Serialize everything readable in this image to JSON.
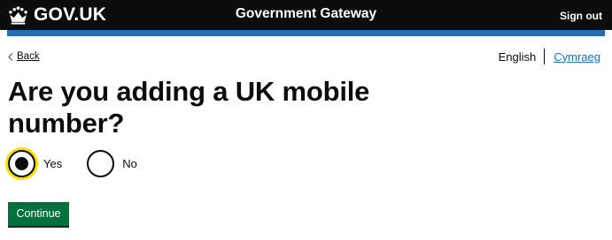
{
  "header": {
    "logo_text": "GOV.UK",
    "logo_icon": "crown-icon",
    "service_name": "Government Gateway",
    "sign_out_label": "Sign out",
    "background_color": "#0b0c0c",
    "accent_bar_color": "#1d70b8"
  },
  "nav": {
    "back_label": "Back",
    "back_icon": "chevron-left-icon"
  },
  "language": {
    "current": "English",
    "alternate": "Cymraeg",
    "link_color": "#1d70b8"
  },
  "question": {
    "title": "Are you adding a UK mobile number?"
  },
  "radios": {
    "options": [
      {
        "label": "Yes",
        "checked": true
      },
      {
        "label": "No",
        "checked": false
      }
    ],
    "focus_color": "#ffdd00"
  },
  "form": {
    "continue_label": "Continue",
    "button_color": "#00703c"
  }
}
